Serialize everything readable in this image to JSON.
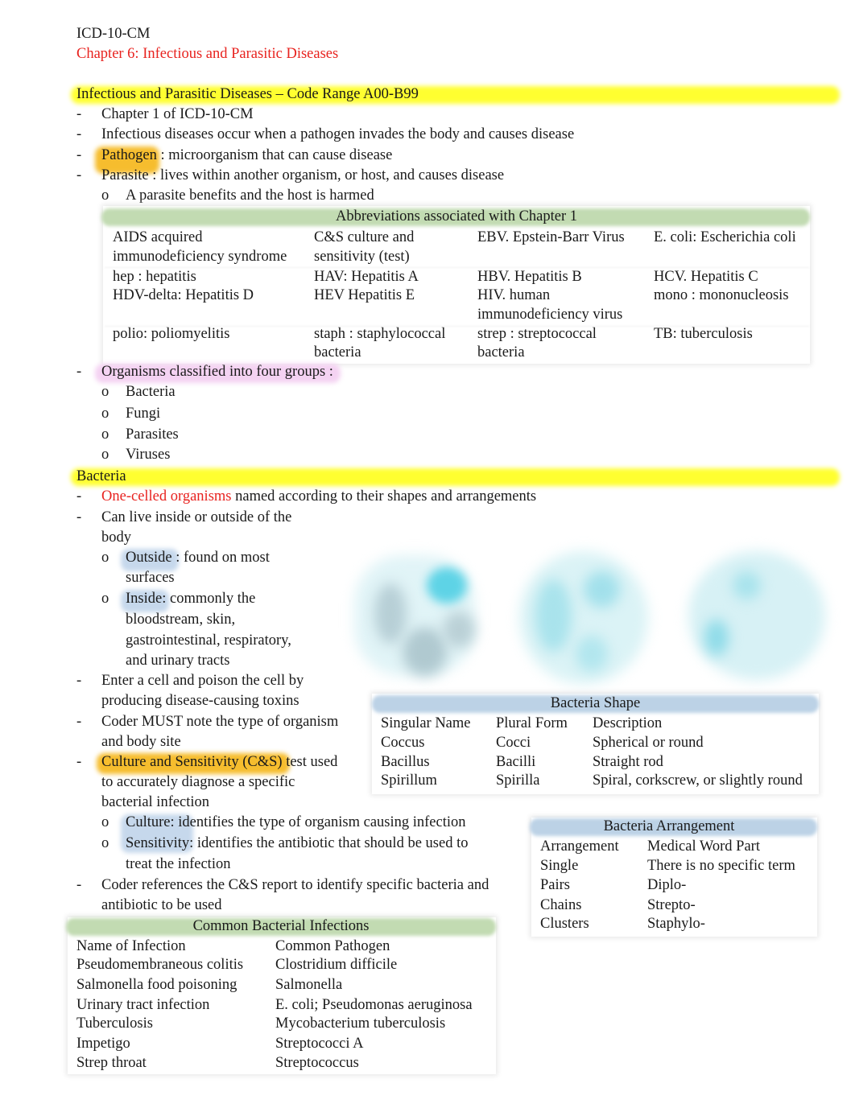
{
  "doc": {
    "title": "ICD-10-CM",
    "chapter": "Chapter 6: Infectious and Parasitic Diseases",
    "colors": {
      "chapter_text": "#e8231f",
      "yellow_highlight": "#ffff30",
      "orange_highlight": "#f6bd2e",
      "pink_highlight": "#f4d2f2",
      "blue_highlight": "#c6d8ec",
      "green_table_header": "#c2dbb2",
      "blue_table_header": "#bcd2e6"
    }
  },
  "section1": {
    "heading": "Infectious and Parasitic Diseases – Code Range A00-B99",
    "items": [
      {
        "bullet": "-",
        "text": "Chapter 1 of ICD-10-CM"
      },
      {
        "bullet": "-",
        "text": "Infectious diseases occur when a pathogen invades the body and causes disease"
      },
      {
        "bullet": "-",
        "term": "Pathogen",
        "text": " : microorganism that can cause disease"
      },
      {
        "bullet": "-",
        "term": "Parasite",
        "text": " : lives within another organism, or host, and causes disease"
      },
      {
        "bullet": "o",
        "text": "A parasite benefits and the host is harmed"
      }
    ]
  },
  "abbrev_table": {
    "title": "Abbreviations associated with Chapter 1",
    "rows": [
      [
        "AIDS: acquired immunodeficiency syndrome",
        "C&S: culture and sensitivity (test)",
        "EBV: Epstein-Barr Virus",
        "E. coli: Escherichia coli"
      ],
      [
        "hep: hepatitis",
        "HAV: Hepatitis A",
        "HBV: Hepatitis B",
        "HCV: Hepatitis C"
      ],
      [
        "HDV-delta: Hepatitis D",
        "HEV: Hepatitis E",
        "HIV: human immunodeficiency virus",
        "mono: mononucleosis"
      ],
      [
        "polio: poliomyelitis",
        "staph: staphylococcal bacteria",
        "strep: streptococcal bacteria",
        "TB: tuberculosis"
      ]
    ],
    "display": {
      "r0c0a": "AIDS acquired",
      "r0c0b": "immunodeficiency syndrome",
      "r0c1a": "C&S culture and",
      "r0c1b": "sensitivity (test)",
      "r0c2a": "EBV. Epstein-Barr Virus",
      "r0c3a": "E. coli: Escherichia coli",
      "r1c0": "hep : hepatitis",
      "r1c1": "HAV: Hepatitis A",
      "r1c2": "HBV. Hepatitis B",
      "r1c3": "HCV. Hepatitis C",
      "r2c0": "HDV-delta: Hepatitis D",
      "r2c1": "HEV Hepatitis E",
      "r2c2a": "HIV. human",
      "r2c2b": "immunodeficiency virus",
      "r2c3": "mono : mononucleosis",
      "r3c0": "polio: poliomyelitis",
      "r3c1a": "staph : staphylococcal",
      "r3c1b": "bacteria",
      "r3c2a": "strep : streptococcal",
      "r3c2b": "bacteria",
      "r3c3": "TB: tuberculosis"
    }
  },
  "organisms": {
    "intro": "Organisms classified into four groups :",
    "groups": [
      "Bacteria",
      "Fungi",
      "Parasites",
      "Viruses"
    ]
  },
  "bacteria": {
    "heading": "Bacteria",
    "one_celled_term": "One-celled organisms",
    "one_celled_text": " named according to their shapes and arrangements",
    "live_line1": "Can live inside or outside of the",
    "live_line2": "body",
    "outside_term": "Outside",
    "outside_text1": " : found on most",
    "outside_text2": "surfaces",
    "inside_term": "Inside",
    "inside_text1": ": commonly the",
    "inside_text2": "bloodstream, skin,",
    "inside_text3": "gastrointestinal, respiratory,",
    "inside_text4": "and urinary tracts",
    "enter_line1": "Enter a cell and poison the cell by",
    "enter_line2": "producing disease-causing toxins",
    "coder_line1": "Coder MUST note the type of organism",
    "coder_line2": "and body site",
    "cs_term": "Culture and Sensitivity (C&S)",
    "cs_text1": " test used",
    "cs_text2": "to accurately diagnose a specific",
    "cs_text3": "bacterial infection",
    "culture_term": "Culture",
    "culture_text": ": identifies the type of organism causing infection",
    "sensitivity_term": "Sensitivity",
    "sensitivity_text1": ": identifies the antibiotic that should be used to",
    "sensitivity_text2": "treat the infection",
    "ref_line1": "Coder references the C&S report to identify specific bacteria and",
    "ref_line2": "antibiotic to be used",
    "figure_label": "bacteria-shape-illustrations"
  },
  "shape_table": {
    "title": "Bacteria Shape",
    "headers": [
      "Singular Name",
      "Plural Form",
      "Description"
    ],
    "rows": [
      [
        "Coccus",
        "Cocci",
        "Spherical or round"
      ],
      [
        "Bacillus",
        "Bacilli",
        "Straight rod"
      ],
      [
        "Spirillum",
        "Spirilla",
        "Spiral, corkscrew, or slightly round"
      ]
    ]
  },
  "arrangement_table": {
    "title": "Bacteria Arrangement",
    "headers": [
      "Arrangement",
      "Medical Word Part"
    ],
    "rows": [
      [
        "Single",
        "There is no specific term"
      ],
      [
        "Pairs",
        "Diplo-"
      ],
      [
        "Chains",
        "Strepto-"
      ],
      [
        "Clusters",
        "Staphylo-"
      ]
    ]
  },
  "infection_table": {
    "title": "Common Bacterial Infections",
    "headers": [
      "Name of Infection",
      "Common Pathogen"
    ],
    "rows": [
      [
        "Pseudomembraneous colitis",
        "Clostridium difficile"
      ],
      [
        "Salmonella food poisoning",
        "Salmonella"
      ],
      [
        "Urinary tract infection",
        "E. coli; Pseudomonas aeruginosa"
      ],
      [
        "Tuberculosis",
        "Mycobacterium tuberculosis"
      ],
      [
        "Impetigo",
        "Streptococci A"
      ],
      [
        "Strep throat",
        "Streptococcus"
      ]
    ]
  }
}
